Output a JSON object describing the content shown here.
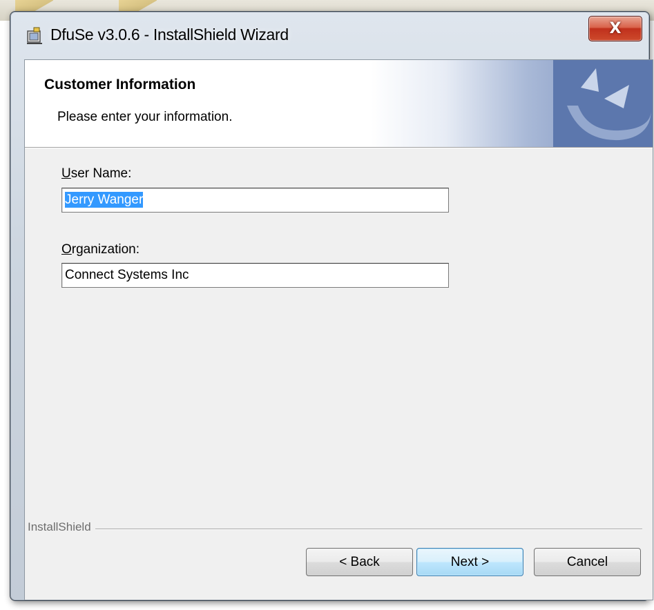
{
  "window": {
    "title": "DfuSe v3.0.6 - InstallShield Wizard",
    "close_label": "X"
  },
  "banner": {
    "title": "Customer Information",
    "subtitle": "Please enter your information."
  },
  "form": {
    "user_name_label_accel": "U",
    "user_name_label_rest": "ser Name:",
    "user_name_value": "Jerry Wanger",
    "organization_label_accel": "O",
    "organization_label_rest": "rganization:",
    "organization_value": "Connect Systems Inc"
  },
  "footer": {
    "brand": "InstallShield",
    "back_label": "< Back",
    "next_label": "Next >",
    "cancel_label": "Cancel"
  },
  "colors": {
    "selection": "#3399ff",
    "banner_accent": "#5c77ad",
    "close_button": "#c0301c"
  },
  "icons": [
    "installer-icon",
    "close-icon",
    "installshield-logo-icon"
  ]
}
